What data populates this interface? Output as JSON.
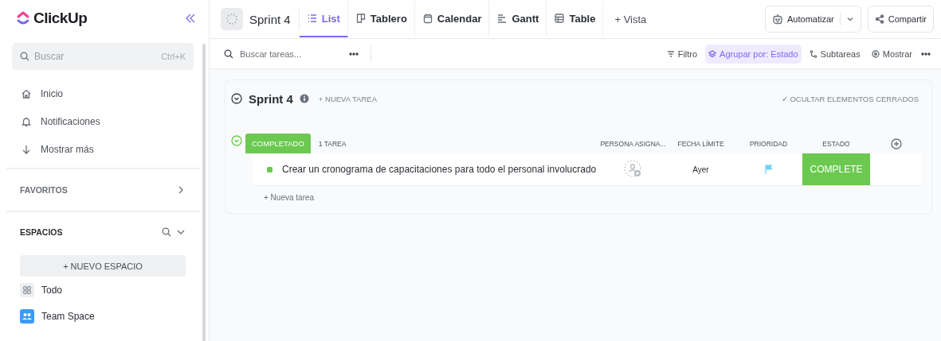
{
  "sidebar": {
    "logo": "ClickUp",
    "search": {
      "placeholder": "Buscar",
      "shortcut": "Ctrl+K"
    },
    "nav": [
      {
        "kind": "home",
        "label": "Inicio"
      },
      {
        "kind": "bell",
        "label": "Notificaciones"
      },
      {
        "kind": "down",
        "label": "Mostrar más"
      }
    ],
    "favorites": {
      "title": "FAVORITOS"
    },
    "spaces": {
      "title": "ESPACIOS",
      "new_button": "+ NUEVO ESPACIO",
      "items": [
        {
          "kind": "all",
          "label": "Todo",
          "selected": false
        },
        {
          "kind": "team",
          "label": "Team Space",
          "selected": false
        }
      ]
    }
  },
  "header": {
    "title": "Sprint 4",
    "tabs": [
      {
        "kind": "list",
        "label": "List",
        "selected": true
      },
      {
        "kind": "board",
        "label": "Tablero",
        "selected": false
      },
      {
        "kind": "calendar",
        "label": "Calendar",
        "selected": false
      },
      {
        "kind": "gantt",
        "label": "Gantt",
        "selected": false
      },
      {
        "kind": "table",
        "label": "Table",
        "selected": false
      }
    ],
    "add_view": "+ Vista",
    "automate": "Automatizar",
    "share": "Compartir"
  },
  "toolbar": {
    "search": {
      "placeholder": "Buscar tareas..."
    },
    "filter": "Filtro",
    "group_by": {
      "label": "Agrupar por: Estado",
      "selected": true
    },
    "subtasks": "Subtareas",
    "show": "Mostrar"
  },
  "list": {
    "title": "Sprint 4",
    "new_task": "+ NUEVA TAREA",
    "hide_closed": "✓ OCULTAR ELEMENTOS CERRADOS",
    "groups": [
      {
        "status": "COMPLETADO",
        "color": "#6bc950",
        "count": "1 TAREA",
        "columns": [
          "PERSONA ASIGNA...",
          "FECHA LÍMITE",
          "PRIORIDAD",
          "ESTADO"
        ],
        "tasks": [
          {
            "name": "Crear un cronograma de capacitaciones para todo el personal involucrado",
            "due": "Ayer",
            "status": "COMPLETE",
            "color": "#6bc950"
          }
        ],
        "add_task": "+ Nueva tarea"
      }
    ]
  }
}
